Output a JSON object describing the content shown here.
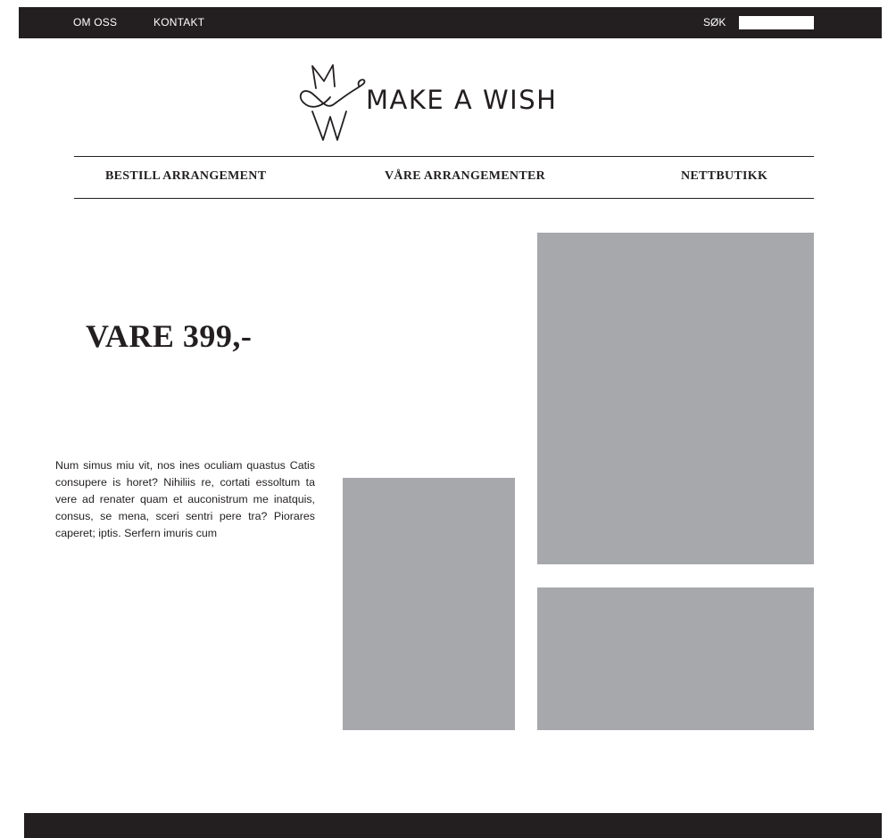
{
  "topbar": {
    "links": [
      "OM OSS",
      "KONTAKT"
    ],
    "search_label": "SØK",
    "search_value": ""
  },
  "logo": {
    "text": "MAKE A WISH",
    "icon": "mw-monogram-icon"
  },
  "main_nav": {
    "items": [
      "BESTILL ARRANGEMENT",
      "VÅRE ARRANGEMENTER",
      "NETTBUTIKK"
    ]
  },
  "product": {
    "price": "VARE 399,-",
    "description": "Num simus miu vit, nos ines oculiam qu­astus Catis consupere is horet? Nihiliis re, cortati essoltum ta vere ad renater quam et auconistrum me inatquis, con­sus, se mena, sceri sentri pere tra? Pio­rares caperet; iptis. Serfern imuris cum"
  },
  "colors": {
    "dark": "#231f20",
    "placeholder": "#a7a8ab",
    "background": "#ffffff"
  }
}
